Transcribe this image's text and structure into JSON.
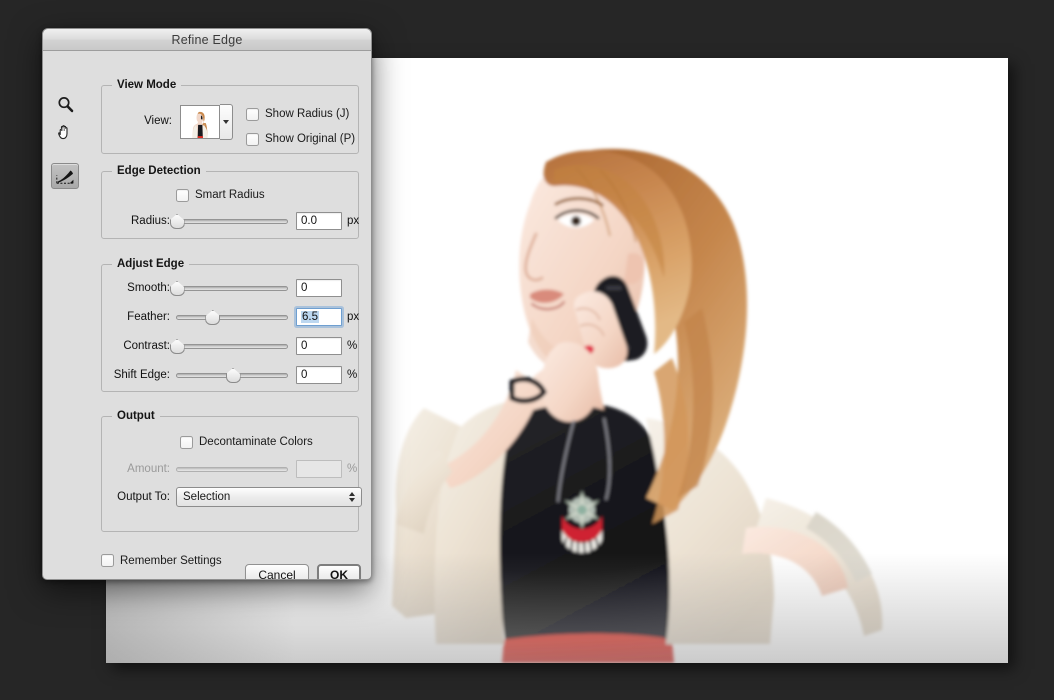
{
  "app": {
    "background_color": "#262626",
    "canvas_color": "#ffffff"
  },
  "dialog": {
    "title": "Refine Edge",
    "tools": [
      {
        "name": "zoom-tool",
        "icon": "magnifier-icon",
        "selected": false
      },
      {
        "name": "hand-tool",
        "icon": "hand-icon",
        "selected": false
      },
      {
        "name": "refine-radius-tool",
        "icon": "refine-brush-icon",
        "selected": true
      }
    ],
    "view_mode": {
      "legend": "View Mode",
      "view_label": "View:",
      "thumbnail_alt": "preview-thumbnail",
      "show_radius": {
        "label": "Show Radius (J)",
        "checked": false
      },
      "show_original": {
        "label": "Show Original (P)",
        "checked": false
      }
    },
    "edge_detection": {
      "legend": "Edge Detection",
      "smart_radius": {
        "label": "Smart Radius",
        "checked": false
      },
      "radius": {
        "label": "Radius:",
        "value": "0.0",
        "unit": "px",
        "percent": 0,
        "min": 0,
        "max": 250
      }
    },
    "adjust_edge": {
      "legend": "Adjust Edge",
      "smooth": {
        "label": "Smooth:",
        "value": "0",
        "unit": "",
        "percent": 0,
        "min": 0,
        "max": 100
      },
      "feather": {
        "label": "Feather:",
        "value": "6.5",
        "unit": "px",
        "percent": 32,
        "min": 0,
        "max": 250,
        "focused": true
      },
      "contrast": {
        "label": "Contrast:",
        "value": "0",
        "unit": "%",
        "percent": 0,
        "min": 0,
        "max": 100
      },
      "shift_edge": {
        "label": "Shift Edge:",
        "value": "0",
        "unit": "%",
        "percent": 50,
        "min": -100,
        "max": 100
      }
    },
    "output": {
      "legend": "Output",
      "decontaminate_colors": {
        "label": "Decontaminate Colors",
        "checked": false
      },
      "amount": {
        "label": "Amount:",
        "value": "",
        "unit": "%",
        "percent": 100,
        "disabled": true
      },
      "output_to": {
        "label": "Output To:",
        "value": "Selection"
      }
    },
    "footer": {
      "remember_settings": {
        "label": "Remember Settings",
        "checked": false
      },
      "cancel_label": "Cancel",
      "ok_label": "OK"
    }
  },
  "photo": {
    "subject": "woman-on-phone",
    "hair_color": "#c98a55",
    "skin_color": "#f6d9cb",
    "top_color": "#1b1b1f",
    "cardigan_color": "#ece3d6",
    "trousers_color": "#e12b23",
    "phone_color": "#1a1a1c"
  }
}
